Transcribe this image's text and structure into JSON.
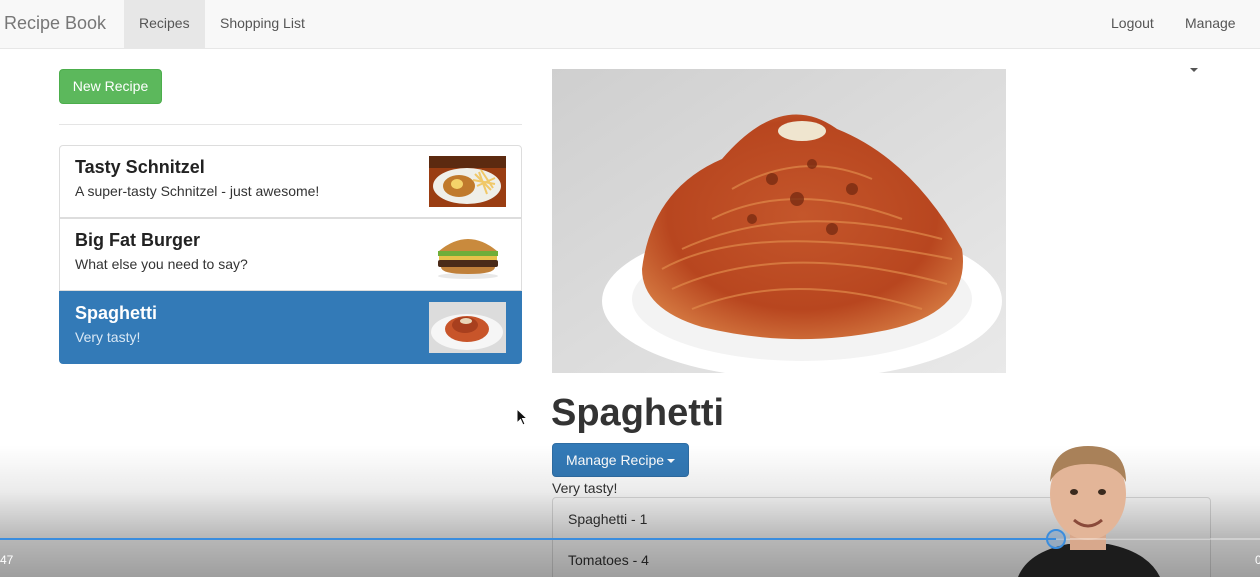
{
  "navbar": {
    "brand": "Recipe Book",
    "tabs": [
      {
        "label": "Recipes",
        "active": true
      },
      {
        "label": "Shopping List",
        "active": false
      }
    ],
    "logout_label": "Logout",
    "manage_label": "Manage"
  },
  "sidebar": {
    "new_recipe_label": "New Recipe",
    "recipes": [
      {
        "name": "Tasty Schnitzel",
        "description": "A super-tasty Schnitzel - just awesome!",
        "active": false
      },
      {
        "name": "Big Fat Burger",
        "description": "What else you need to say?",
        "active": false
      },
      {
        "name": "Spaghetti",
        "description": "Very tasty!",
        "active": true
      }
    ]
  },
  "detail": {
    "title": "Spaghetti",
    "manage_recipe_label": "Manage Recipe",
    "description": "Very tasty!",
    "ingredients": [
      "Spaghetti - 1",
      "Tomatoes - 4"
    ]
  },
  "player": {
    "time_left": "47",
    "time_right": "0",
    "progress": 0.838
  },
  "colors": {
    "success": "#5cb85c",
    "primary": "#337ab7",
    "navbar_bg": "#f8f8f8",
    "progress": "#3a8dde"
  }
}
